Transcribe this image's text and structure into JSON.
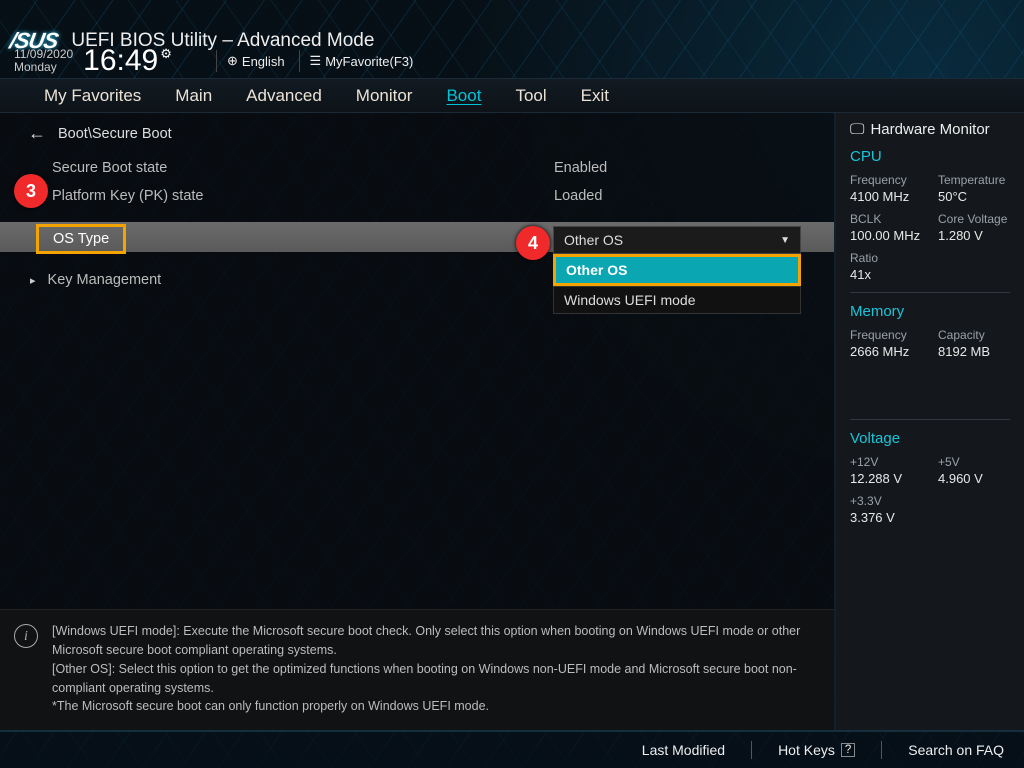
{
  "app_title": "UEFI BIOS Utility – Advanced Mode",
  "brand": "/SUS",
  "date": "11/09/2020",
  "day": "Monday",
  "time": "16:49",
  "language": "English",
  "favorite": "MyFavorite(F3)",
  "menu": [
    "My Favorites",
    "Main",
    "Advanced",
    "Monitor",
    "Boot",
    "Tool",
    "Exit"
  ],
  "active_menu": "Boot",
  "breadcrumb": "Boot\\Secure Boot",
  "rows": {
    "secure_boot_state": {
      "label": "Secure Boot state",
      "value": "Enabled"
    },
    "pk_state": {
      "label": "Platform Key (PK) state",
      "value": "Loaded"
    },
    "os_type": {
      "label": "OS Type",
      "value": "Other OS"
    },
    "key_mgmt": {
      "label": "Key Management"
    }
  },
  "dropdown": {
    "selected": "Other OS",
    "options": [
      "Other OS",
      "Windows UEFI mode"
    ]
  },
  "callouts": {
    "c3": "3",
    "c4": "4"
  },
  "help": {
    "line1": "[Windows UEFI mode]: Execute the Microsoft secure boot check. Only select this option when booting on Windows UEFI mode or other Microsoft secure boot compliant operating systems.",
    "line2": "[Other OS]: Select this option to get the optimized functions when booting on Windows non-UEFI mode and Microsoft secure boot non-compliant operating systems.",
    "line3": "*The Microsoft secure boot can only function properly on Windows UEFI mode."
  },
  "hw": {
    "title": "Hardware Monitor",
    "cpu": {
      "head": "CPU",
      "freq": {
        "l": "Frequency",
        "v": "4100 MHz"
      },
      "temp": {
        "l": "Temperature",
        "v": "50°C"
      },
      "bclk": {
        "l": "BCLK",
        "v": "100.00 MHz"
      },
      "cv": {
        "l": "Core Voltage",
        "v": "1.280 V"
      },
      "ratio": {
        "l": "Ratio",
        "v": "41x"
      }
    },
    "mem": {
      "head": "Memory",
      "freq": {
        "l": "Frequency",
        "v": "2666 MHz"
      },
      "cap": {
        "l": "Capacity",
        "v": "8192 MB"
      }
    },
    "volt": {
      "head": "Voltage",
      "v12": {
        "l": "+12V",
        "v": "12.288 V"
      },
      "v5": {
        "l": "+5V",
        "v": "4.960 V"
      },
      "v33": {
        "l": "+3.3V",
        "v": "3.376 V"
      }
    }
  },
  "bottom": {
    "last": "Last Modified",
    "hotkeys": "Hot Keys",
    "hk_key": "?",
    "faq": "Search on FAQ"
  }
}
